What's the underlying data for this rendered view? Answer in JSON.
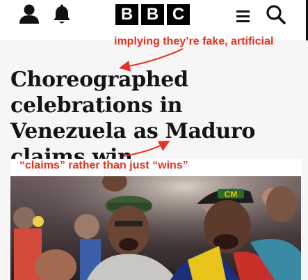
{
  "header": {
    "logo_letters": [
      "B",
      "B",
      "C"
    ],
    "icons": [
      "user-icon",
      "bell-icon",
      "menu-icon",
      "search-icon"
    ]
  },
  "article": {
    "headline": "Choreographed celebrations in Venezuela as Maduro claims win"
  },
  "annotations": {
    "top_note": "implying they’re fake, artificial",
    "mid_note": "“claims” rather than just “wins”",
    "color": "#e53222"
  },
  "photo": {
    "hat_text": "CM"
  }
}
